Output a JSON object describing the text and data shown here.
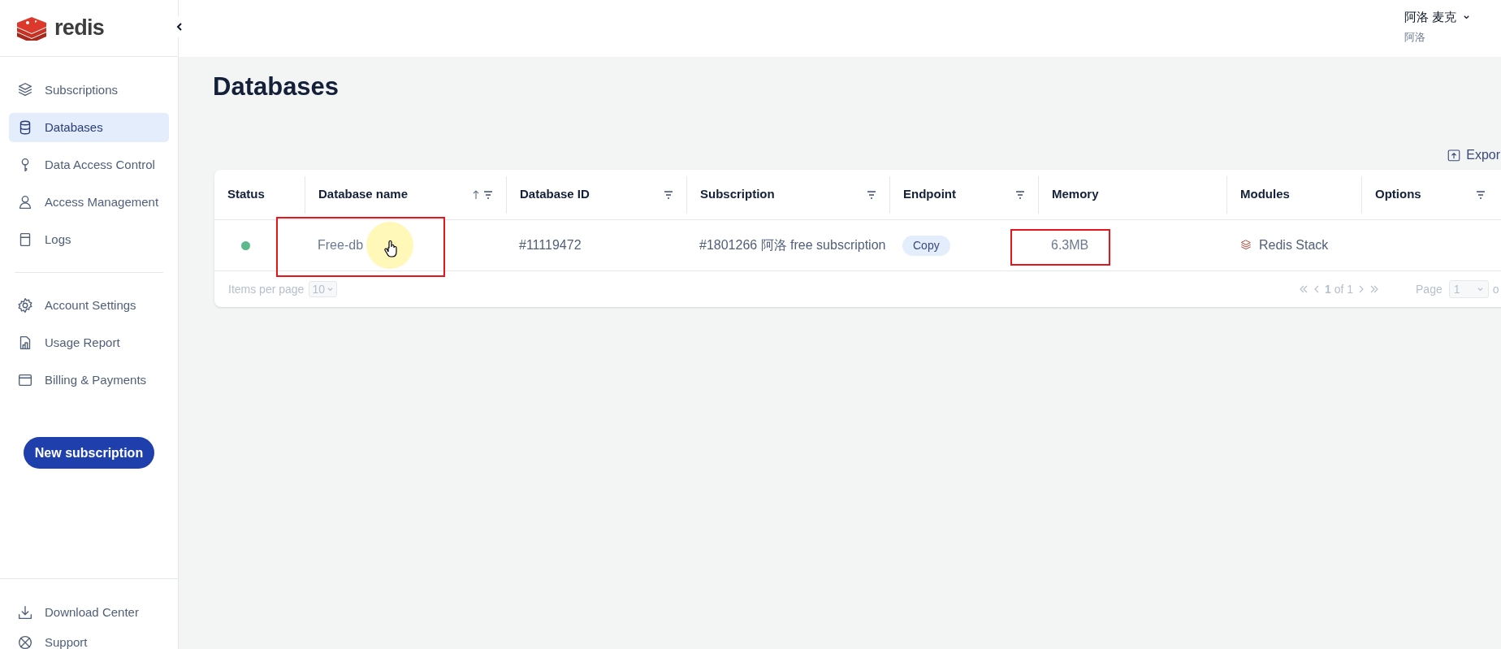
{
  "sidebar": {
    "logo": "redis",
    "nav": [
      {
        "label": "Subscriptions",
        "kind": "layers",
        "selected": false
      },
      {
        "label": "Databases",
        "kind": "database",
        "selected": true
      },
      {
        "label": "Data Access Control",
        "kind": "key",
        "selected": false
      },
      {
        "label": "Access Management",
        "kind": "user",
        "selected": false
      },
      {
        "label": "Logs",
        "kind": "logs",
        "selected": false
      }
    ],
    "settings": [
      {
        "label": "Account Settings",
        "kind": "gear",
        "selected": false
      },
      {
        "label": "Usage Report",
        "kind": "report",
        "selected": false
      },
      {
        "label": "Billing & Payments",
        "kind": "card",
        "selected": false
      }
    ],
    "new_button": "New subscription",
    "bottom": [
      {
        "label": "Download Center",
        "kind": "download"
      },
      {
        "label": "Support",
        "kind": "support"
      }
    ]
  },
  "user": {
    "name": "阿洛 麦克",
    "account": "阿洛"
  },
  "page_title": "Databases",
  "export_button": "Expor",
  "table": {
    "columns": [
      {
        "label": "Status",
        "sorted": false,
        "filter": false
      },
      {
        "label": "Database name",
        "sorted": true,
        "filter": true
      },
      {
        "label": "Database ID",
        "sorted": false,
        "filter": true
      },
      {
        "label": "Subscription",
        "sorted": false,
        "filter": true
      },
      {
        "label": "Endpoint",
        "sorted": false,
        "filter": true
      },
      {
        "label": "Memory",
        "sorted": false,
        "filter": false
      },
      {
        "label": "Modules",
        "sorted": false,
        "filter": false
      },
      {
        "label": "Options",
        "sorted": false,
        "filter": true
      }
    ],
    "rows": [
      {
        "color": "#5bb98c",
        "name": "Free-db",
        "id": "#11119472",
        "subscription": "#1801266 阿洛 free subscription",
        "endpoint_button": "Copy",
        "memory": "6.3MB",
        "module": "Redis Stack",
        "highlight_name": true,
        "highlight_memory": true,
        "cursor_on_name": true
      }
    ],
    "footer": {
      "items_per_page_label": "Items per page",
      "items_per_page": "10",
      "range": "**1** of 1",
      "page_label": "Page",
      "page": "1",
      "page_of": "o"
    }
  }
}
